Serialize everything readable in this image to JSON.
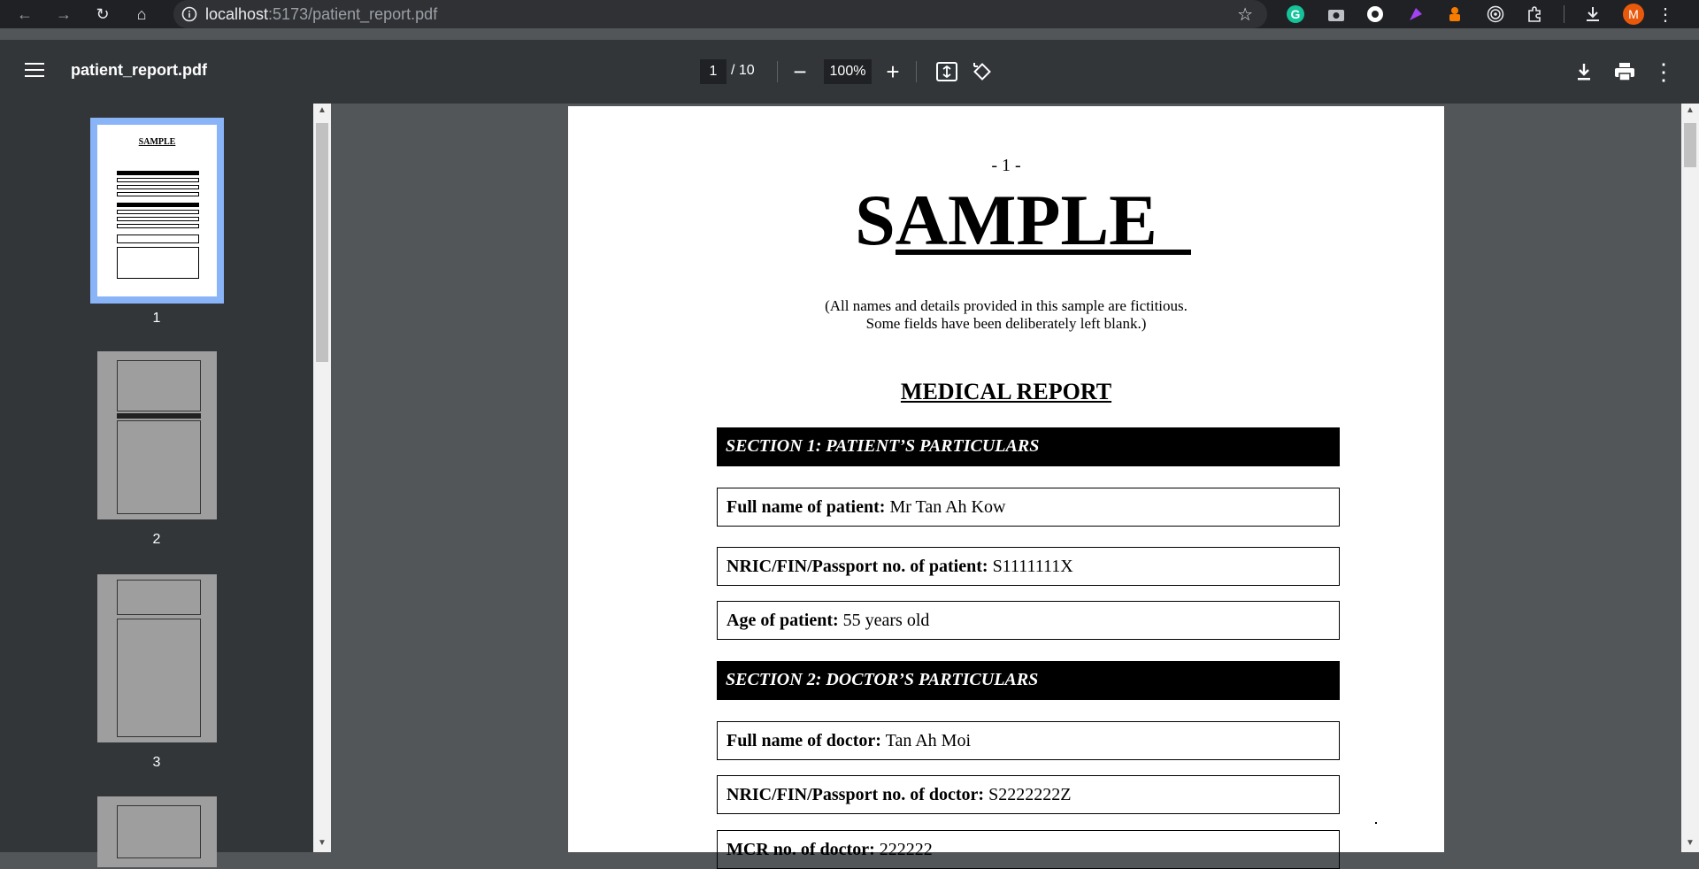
{
  "browser": {
    "url_host": "localhost",
    "url_path": ":5173/patient_report.pdf",
    "avatar_letter": "M"
  },
  "toolbar": {
    "file_name": "patient_report.pdf",
    "current_page": "1",
    "total_pages": "/ 10",
    "zoom": "100%"
  },
  "sidebar": {
    "thumbnails": [
      {
        "label": "1",
        "selected": true
      },
      {
        "label": "2",
        "selected": false
      },
      {
        "label": "3",
        "selected": false
      }
    ]
  },
  "document": {
    "page_marker": "- 1 -",
    "watermark": "SAMPLE",
    "disclaimer_line1": "(All names and details provided in this sample are fictitious.",
    "disclaimer_line2": "Some fields have been deliberately left blank.)",
    "report_title": "MEDICAL REPORT",
    "section1_title": "SECTION 1: PATIENT’S PARTICULARS",
    "section2_title": "SECTION 2: DOCTOR’S PARTICULARS",
    "fields": [
      {
        "label": "Full name of patient:",
        "value": "Mr Tan Ah Kow"
      },
      {
        "label": "NRIC/FIN/Passport no. of patient:",
        "value": "S1111111X"
      },
      {
        "label": "Age of patient:",
        "value": "55 years old"
      },
      {
        "label": "Full name of doctor:",
        "value": "Tan Ah Moi"
      },
      {
        "label": "NRIC/FIN/Passport no. of doctor:",
        "value": "S2222222Z"
      },
      {
        "label": "MCR no. of doctor:",
        "value": "222222"
      }
    ]
  }
}
